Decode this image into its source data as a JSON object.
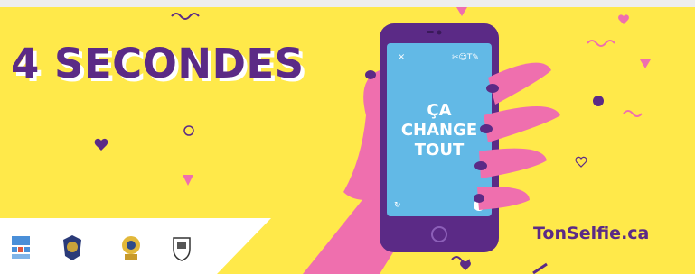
{
  "headline": "4 SECONDES",
  "phone_screen": {
    "lines": [
      "ÇA",
      "CHANGE",
      "TOUT"
    ]
  },
  "website": "TonSelfie.ca",
  "colors": {
    "background": "#ffe94a",
    "purple": "#5b2a86",
    "pink": "#ef6fae",
    "screen_blue": "#62b9e6"
  },
  "logos": [
    "partner-logo-1",
    "police-badge-logo",
    "surete-badge-logo",
    "municipal-crest-logo"
  ]
}
